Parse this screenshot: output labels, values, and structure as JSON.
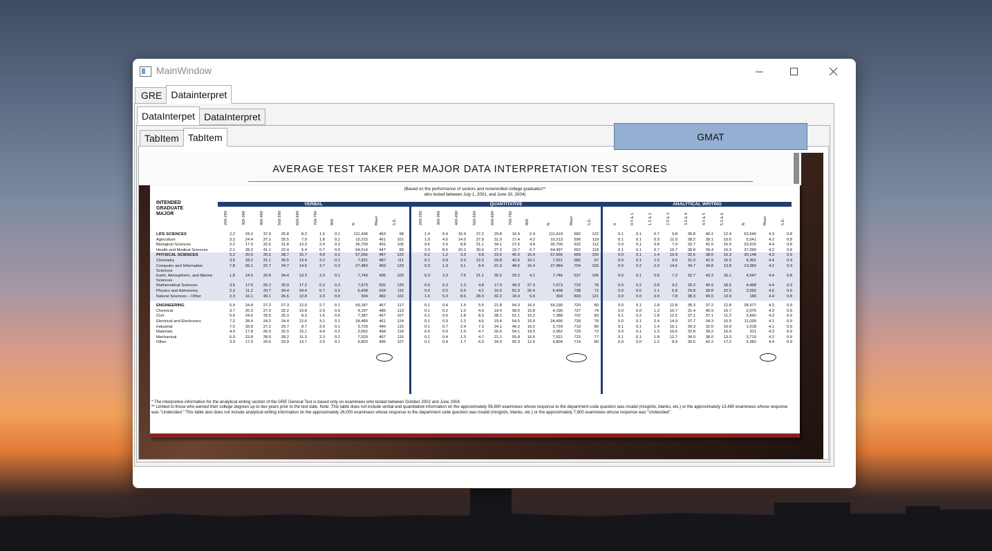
{
  "window": {
    "title": "MainWindow"
  },
  "tabs_outer": [
    {
      "label": "GRE"
    },
    {
      "label": "Datainterpret"
    }
  ],
  "tabs_middle": [
    {
      "label": "DataInterpet"
    },
    {
      "label": "DataInterpret"
    }
  ],
  "tabs_inner": [
    {
      "label": "TabItem"
    },
    {
      "label": "TabItem"
    }
  ],
  "gmat_button": {
    "label": "GMAT"
  },
  "document": {
    "title": "AVERAGE TEST TAKER PER MAJOR DATA INTERPRETATION TEST SCORES",
    "subtitle1": "(Based on the performance of seniors and nonenrolled college graduates**",
    "subtitle2": "who tested between July 1, 2001, and June 30, 2004)",
    "major_header": [
      "INTENDED",
      "GRADUATE",
      "MAJOR"
    ],
    "sections": {
      "verbal": "VERBAL",
      "quantitative": "QUANTITATIVE",
      "analytical": "ANALYTICAL WRITING"
    },
    "verbal_cols": [
      "200-290",
      "300-390",
      "400-490",
      "500-590",
      "600-690",
      "700-790",
      "800",
      "N",
      "Mean",
      "S.D."
    ],
    "quant_cols": [
      "200-290",
      "300-390",
      "400-490",
      "500-590",
      "600-690",
      "700-790",
      "800",
      "N",
      "Mean",
      "S.D."
    ],
    "aw_cols": [
      "0",
      "0.5 & 1",
      "1.5 & 2",
      "2.5 & 3",
      "3.5 & 4",
      "4.5 & 5",
      "5.5 & 6",
      "N",
      "Mean",
      "S.D."
    ],
    "rows": [
      {
        "label": "LIFE SCIENCES",
        "bold": true,
        "v": [
          "2.2",
          "24.2",
          "37.9",
          "25.8",
          "8.2",
          "1.5",
          "0.1",
          "111,438",
          "463",
          "98"
        ],
        "q": [
          "1.4",
          "6.4",
          "15.9",
          "27.2",
          "29.8",
          "16.9",
          "2.4",
          "111,419",
          "582",
          "122"
        ],
        "a": [
          "0.1",
          "0.1",
          "0.7",
          "9.8",
          "36.8",
          "40.2",
          "12.4",
          "63,546",
          "4.3",
          "0.8"
        ]
      },
      {
        "label": "Agriculture",
        "v": [
          "3.2",
          "24.4",
          "37.1",
          "25.5",
          "7.9",
          "1.8",
          "0.1",
          "10,215",
          "461",
          "101"
        ],
        "q": [
          "1.0",
          "4.5",
          "14.0",
          "27.9",
          "31.0",
          "17.4",
          "4.2",
          "10,213",
          "596",
          "119"
        ],
        "a": [
          "0.1",
          "0.1",
          "0.9",
          "11.0",
          "38.2",
          "39.1",
          "10.6",
          "5,541",
          "4.2",
          "0.8"
        ]
      },
      {
        "label": "Biological Sciences",
        "v": [
          "2.2",
          "17.0",
          "32.6",
          "31.8",
          "13.3",
          "2.9",
          "0.2",
          "36,709",
          "491",
          "105"
        ],
        "q": [
          "0.6",
          "2.9",
          "8.8",
          "21.1",
          "34.1",
          "27.6",
          "4.9",
          "36,709",
          "632",
          "112"
        ],
        "a": [
          "0.0",
          "0.1",
          "0.8",
          "7.9",
          "32.7",
          "42.0",
          "16.5",
          "20,915",
          "4.4",
          "0.8"
        ]
      },
      {
        "label": "Health and Medical Sciences",
        "v": [
          "2.1",
          "28.3",
          "41.1",
          "22.4",
          "5.4",
          "0.7",
          "0.0",
          "64,514",
          "447",
          "89"
        ],
        "q": [
          "2.0",
          "8.6",
          "20.2",
          "30.6",
          "27.2",
          "10.7",
          "0.7",
          "64,497",
          "552",
          "118"
        ],
        "a": [
          "0.1",
          "0.1",
          "0.7",
          "10.7",
          "38.8",
          "39.4",
          "10.3",
          "37,090",
          "4.2",
          "0.8"
        ]
      },
      {
        "label": "PHYSICAL SCIENCES",
        "bold": true,
        "band": true,
        "v": [
          "5.2",
          "20.6",
          "25.5",
          "28.7",
          "15.7",
          "4.0",
          "0.2",
          "57,566",
          "487",
          "122"
        ],
        "q": [
          "0.2",
          "1.2",
          "3.3",
          "9.8",
          "23.6",
          "45.5",
          "16.4",
          "57,566",
          "699",
          "100"
        ],
        "a": [
          "0.0",
          "0.1",
          "1.4",
          "10.9",
          "32.6",
          "38.6",
          "16.3",
          "30,148",
          "4.3",
          "0.9"
        ]
      },
      {
        "label": "Chemistry",
        "band": true,
        "v": [
          "3.5",
          "18.2",
          "31.1",
          "30.5",
          "13.4",
          "3.2",
          "0.1",
          "7,921",
          "487",
          "111"
        ],
        "q": [
          "0.2",
          "0.9",
          "3.9",
          "12.5",
          "29.8",
          "42.6",
          "10.1",
          "7,921",
          "682",
          "97"
        ],
        "a": [
          "0.0",
          "0.1",
          "1.5",
          "9.0",
          "31.0",
          "41.9",
          "16.5",
          "4,301",
          "4.4",
          "0.9"
        ]
      },
      {
        "label": "Computer and Information Sciences",
        "band": true,
        "v": [
          "7.8",
          "26.1",
          "22.7",
          "24.7",
          "14.6",
          "3.7",
          "0.3",
          "27,483",
          "469",
          "129"
        ],
        "q": [
          "0.3",
          "1.3",
          "3.1",
          "8.4",
          "21.9",
          "48.6",
          "16.4",
          "27,484",
          "704",
          "100"
        ],
        "a": [
          "0.0",
          "0.2",
          "2.0",
          "14.6",
          "34.7",
          "34.8",
          "13.8",
          "13,060",
          "4.2",
          "0.9"
        ]
      },
      {
        "label": "Earth, Atmospheric, and Marine Sciences",
        "band": true,
        "v": [
          "1.8",
          "14.5",
          "33.6",
          "34.4",
          "13.3",
          "2.3",
          "0.1",
          "7,749",
          "495",
          "100"
        ],
        "q": [
          "0.3",
          "2.3",
          "7.6",
          "21.1",
          "35.5",
          "29.2",
          "4.1",
          "7,746",
          "637",
          "106"
        ],
        "a": [
          "0.0",
          "0.1",
          "0.5",
          "7.2",
          "32.7",
          "43.3",
          "16.1",
          "4,547",
          "4.4",
          "0.8"
        ]
      },
      {
        "label": "Mathematical Sciences",
        "band": true,
        "v": [
          "3.6",
          "17.6",
          "25.2",
          "30.9",
          "17.2",
          "5.3",
          "0.3",
          "7,673",
          "502",
          "120"
        ],
        "q": [
          "0.0",
          "0.3",
          "1.3",
          "4.8",
          "17.0",
          "49.3",
          "27.3",
          "7,673",
          "733",
          "78"
        ],
        "a": [
          "0.0",
          "0.2",
          "0.8",
          "9.2",
          "30.2",
          "40.9",
          "18.6",
          "4,468",
          "4.4",
          "0.9"
        ]
      },
      {
        "label": "Physics and Astronomy",
        "band": true,
        "v": [
          "2.3",
          "11.2",
          "20.7",
          "34.4",
          "24.4",
          "6.7",
          "0.2",
          "6,438",
          "534",
          "115"
        ],
        "q": [
          "0.0",
          "0.2",
          "0.9",
          "4.1",
          "16.0",
          "52.3",
          "26.4",
          "6,438",
          "738",
          "72"
        ],
        "a": [
          "0.0",
          "0.0",
          "1.1",
          "6.8",
          "29.8",
          "39.8",
          "22.5",
          "3,592",
          "4.5",
          "0.9"
        ]
      },
      {
        "label": "Natural Sciences – Other",
        "band": true,
        "v": [
          "2.3",
          "16.1",
          "40.1",
          "26.6",
          "12.8",
          "2.0",
          "0.0",
          "304",
          "482",
          "101"
        ],
        "q": [
          "1.6",
          "5.3",
          "8.6",
          "28.3",
          "32.2",
          "18.4",
          "5.6",
          "304",
          "603",
          "121"
        ],
        "a": [
          "0.0",
          "0.0",
          "0.0",
          "7.8",
          "38.3",
          "40.0",
          "13.9",
          "180",
          "4.4",
          "0.8"
        ]
      },
      {
        "gap": true
      },
      {
        "label": "ENGINEERING",
        "bold": true,
        "v": [
          "5.9",
          "24.8",
          "27.2",
          "27.3",
          "12.0",
          "2.7",
          "0.1",
          "59,187",
          "467",
          "117"
        ],
        "q": [
          "0.1",
          "0.4",
          "1.5",
          "5.5",
          "21.8",
          "54.3",
          "16.5",
          "59,190",
          "720",
          "80"
        ],
        "a": [
          "0.0",
          "0.1",
          "1.8",
          "12.8",
          "35.3",
          "37.2",
          "12.8",
          "28,577",
          "4.2",
          "0.9"
        ]
      },
      {
        "label": "Chemical",
        "v": [
          "3.7",
          "20.3",
          "27.0",
          "32.2",
          "13.8",
          "2.9",
          "0.0",
          "4,197",
          "485",
          "113"
        ],
        "q": [
          "0.1",
          "0.2",
          "1.0",
          "4.9",
          "19.4",
          "58.6",
          "15.8",
          "4,196",
          "727",
          "74"
        ],
        "a": [
          "0.0",
          "0.0",
          "1.3",
          "10.7",
          "31.4",
          "40.9",
          "15.7",
          "2,075",
          "4.3",
          "0.9"
        ]
      },
      {
        "label": "Civil",
        "v": [
          "5.6",
          "24.6",
          "33.5",
          "26.3",
          "8.3",
          "1.6",
          "0.0",
          "7,387",
          "457",
          "107"
        ],
        "q": [
          "0.1",
          "0.5",
          "1.8",
          "8.3",
          "28.1",
          "51.1",
          "10.2",
          "7,388",
          "702",
          "83"
        ],
        "a": [
          "0.1",
          "0.2",
          "1.8",
          "12.5",
          "37.1",
          "37.1",
          "11.2",
          "3,842",
          "4.2",
          "0.9"
        ]
      },
      {
        "label": "Electrical and Electronics",
        "v": [
          "7.2",
          "28.4",
          "24.2",
          "24.4",
          "12.6",
          "3.1",
          "0.1",
          "24,489",
          "461",
          "124"
        ],
        "q": [
          "0.1",
          "0.3",
          "1.3",
          "4.5",
          "19.4",
          "54.5",
          "19.9",
          "24,496",
          "728",
          "78"
        ],
        "a": [
          "0.0",
          "0.1",
          "2.4",
          "14.9",
          "37.7",
          "34.3",
          "10.5",
          "11,039",
          "4.1",
          "0.9"
        ]
      },
      {
        "label": "Industrial",
        "v": [
          "7.5",
          "33.8",
          "27.2",
          "20.7",
          "8.7",
          "2.0",
          "0.1",
          "3,729",
          "440",
          "115"
        ],
        "q": [
          "0.1",
          "0.7",
          "2.4",
          "7.3",
          "24.1",
          "49.2",
          "16.2",
          "3,729",
          "710",
          "89"
        ],
        "a": [
          "0.1",
          "0.1",
          "1.4",
          "16.1",
          "39.3",
          "32.0",
          "10.9",
          "1,618",
          "4.1",
          "0.9"
        ]
      },
      {
        "label": "Materials",
        "v": [
          "4.0",
          "17.8",
          "26.5",
          "32.0",
          "15.1",
          "4.4",
          "0.2",
          "2,062",
          "494",
          "118"
        ],
        "q": [
          "0.0",
          "0.0",
          "1.0",
          "4.7",
          "20.6",
          "54.1",
          "19.5",
          "2,062",
          "729",
          "72"
        ],
        "a": [
          "0.0",
          "0.1",
          "1.3",
          "10.6",
          "32.8",
          "39.2",
          "15.9",
          "911",
          "4.3",
          "0.9"
        ]
      },
      {
        "label": "Mechanical",
        "v": [
          "6.3",
          "23.8",
          "28.0",
          "28.2",
          "11.3",
          "2.3",
          "0.1",
          "7,520",
          "467",
          "115"
        ],
        "q": [
          "0.1",
          "0.4",
          "1.3",
          "4.7",
          "21.1",
          "55.8",
          "16.6",
          "7,521",
          "723",
          "77"
        ],
        "a": [
          "0.1",
          "0.1",
          "1.8",
          "12.7",
          "34.0",
          "38.0",
          "13.3",
          "3,710",
          "4.2",
          "0.9"
        ]
      },
      {
        "label": "Other",
        "v": [
          "3.3",
          "17.0",
          "29.6",
          "33.9",
          "13.7",
          "2.5",
          "0.1",
          "9,803",
          "490",
          "107"
        ],
        "q": [
          "0.1",
          "0.4",
          "1.7",
          "6.0",
          "24.0",
          "55.3",
          "12.6",
          "9,804",
          "714",
          "80"
        ],
        "a": [
          "0.0",
          "0.0",
          "1.2",
          "8.9",
          "30.5",
          "42.2",
          "17.2",
          "5,382",
          "4.4",
          "0.9"
        ]
      }
    ],
    "footnote1": "* The interpretive information for the analytical writing section of the GRE General Test is based only on examinees who tested between October 2002 and June 2004.",
    "footnote2": "** Limited to those who earned their college degrees up to two years prior to the test date. Note: This table does not include verbal and quantitative information on the approximately 56,600 examinees whose response to the department code question was invalid (misgrids, blanks, etc.) or the approximately 13,480 examinees whose response was \"Undecided.\" This table also does not include analytical writing information on the approximately 26,000 examinees whose response to the department code question was invalid (misgrids, blanks, etc.) or the approximately 7,600 examinees whose response was \"Undecided\"."
  }
}
